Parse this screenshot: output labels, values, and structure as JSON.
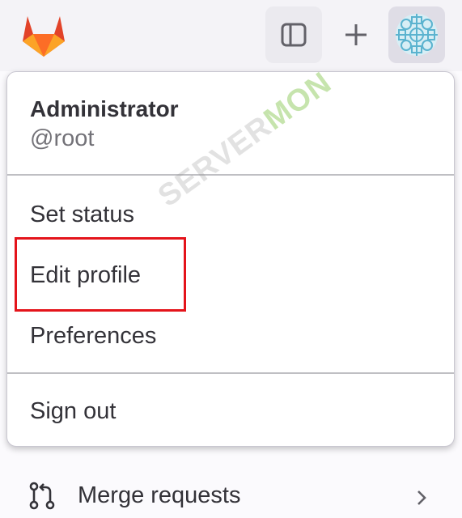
{
  "topbar": {
    "sidebar_toggle_icon": "sidebar-panel-icon",
    "new_icon": "plus-icon",
    "avatar_icon": "user-avatar"
  },
  "dropdown": {
    "user_name": "Administrator",
    "user_handle": "@root",
    "items": [
      {
        "label": "Set status"
      },
      {
        "label": "Edit profile",
        "highlighted": true
      },
      {
        "label": "Preferences"
      },
      {
        "label": "Sign out"
      }
    ]
  },
  "sidebar": {
    "merge_requests_label": "Merge requests"
  },
  "colors": {
    "highlight_border": "#e4141b",
    "accent": "#fc6d26"
  }
}
